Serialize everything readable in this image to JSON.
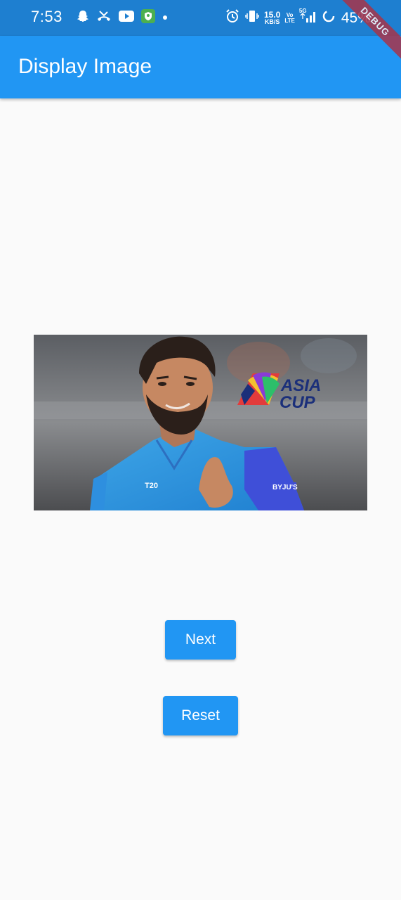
{
  "status_bar": {
    "time": "7:53",
    "net_speed_value": "15.0",
    "net_speed_unit": "KB/S",
    "volte_top": "Vo",
    "volte_bottom": "LTE",
    "network": "5G",
    "battery": "45%",
    "left_icons": [
      "snapchat-icon",
      "missed-call-icon",
      "youtube-icon",
      "shield-app-icon",
      "dot-icon"
    ],
    "right_icons": [
      "alarm-icon",
      "vibrate-icon",
      "signal-icon",
      "battery-saver-icon"
    ]
  },
  "app_bar": {
    "title": "Display Image"
  },
  "debug_banner": "DEBUG",
  "image": {
    "logo_line1": "ASIA",
    "logo_line2": "CUP",
    "sponsor_text": "BYJU'S"
  },
  "buttons": {
    "next_label": "Next",
    "reset_label": "Reset"
  },
  "colors": {
    "status_bar": "#1e7fd0",
    "app_bar": "#2196f3",
    "button": "#2196f3",
    "background": "#fafafa"
  }
}
